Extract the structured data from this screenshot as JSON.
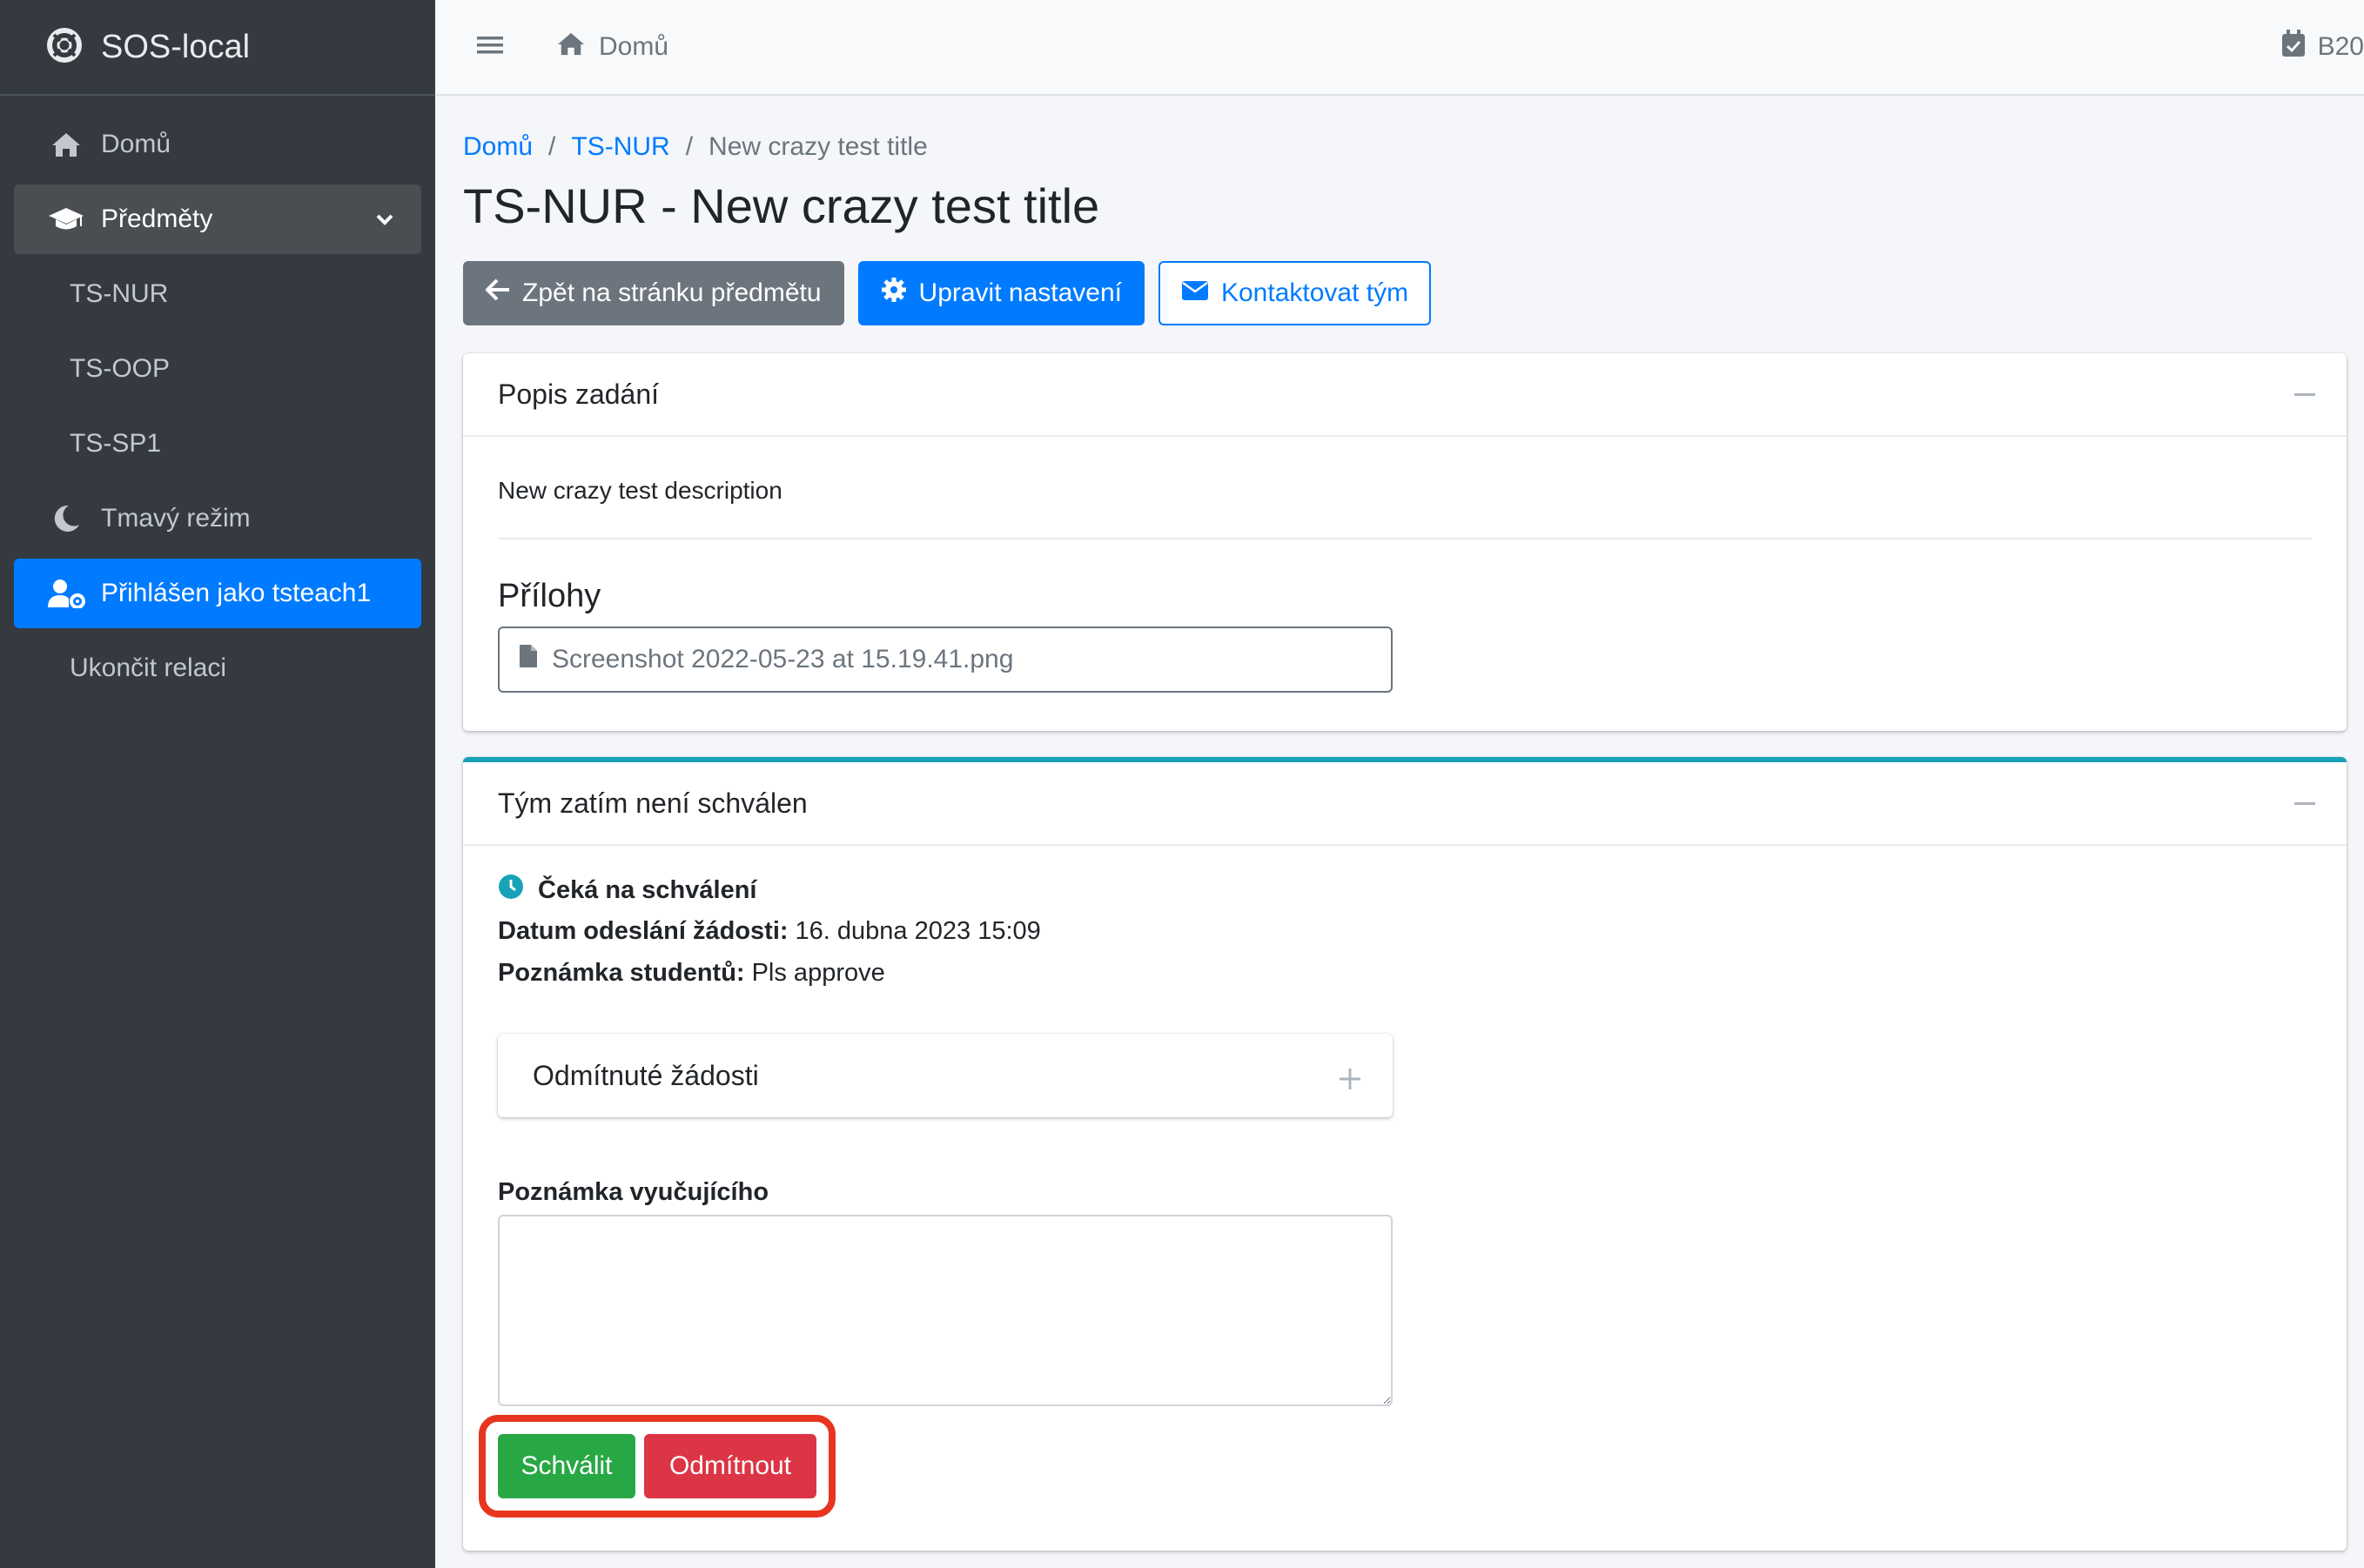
{
  "sidebar": {
    "brand": "SOS-local",
    "items": [
      {
        "label": "Domů",
        "icon": "home-icon"
      },
      {
        "label": "Předměty",
        "icon": "graduation-cap-icon"
      },
      {
        "label": "TS-NUR"
      },
      {
        "label": "TS-OOP"
      },
      {
        "label": "TS-SP1"
      },
      {
        "label": "Tmavý režim",
        "icon": "moon-icon"
      },
      {
        "label": "Přihlášen jako tsteach1",
        "icon": "user-cog-icon"
      },
      {
        "label": "Ukončit relaci"
      }
    ]
  },
  "topbar": {
    "home_label": "Domů",
    "right_label": "B20"
  },
  "breadcrumb": {
    "home": "Domů",
    "course": "TS-NUR",
    "current": "New crazy test title",
    "separator": "/"
  },
  "page_title": "TS-NUR - New crazy test title",
  "actions": {
    "back": "Zpět na stránku předmětu",
    "settings": "Upravit nastavení",
    "contact": "Kontaktovat tým"
  },
  "assignment_card": {
    "header": "Popis zadání",
    "description": "New crazy test description",
    "attachments_title": "Přílohy",
    "attachment_file": "Screenshot 2022-05-23 at 15.19.41.png"
  },
  "team_card": {
    "header": "Tým zatím není schválen",
    "status": "Čeká na schválení",
    "sent_label": "Datum odeslání žádosti:",
    "sent_value": "16. dubna 2023 15:09",
    "note_label": "Poznámka studentů:",
    "note_value": "Pls approve",
    "rejected_title": "Odmítnuté žádosti",
    "teacher_note_label": "Poznámka vyučujícího",
    "approve": "Schválit",
    "reject": "Odmítnout"
  },
  "colors": {
    "sidebar_bg": "#343a40",
    "primary": "#007bff",
    "secondary": "#6c757d",
    "success": "#28a745",
    "danger": "#dc3545",
    "info": "#17a2b8",
    "highlight": "#e8351f"
  }
}
